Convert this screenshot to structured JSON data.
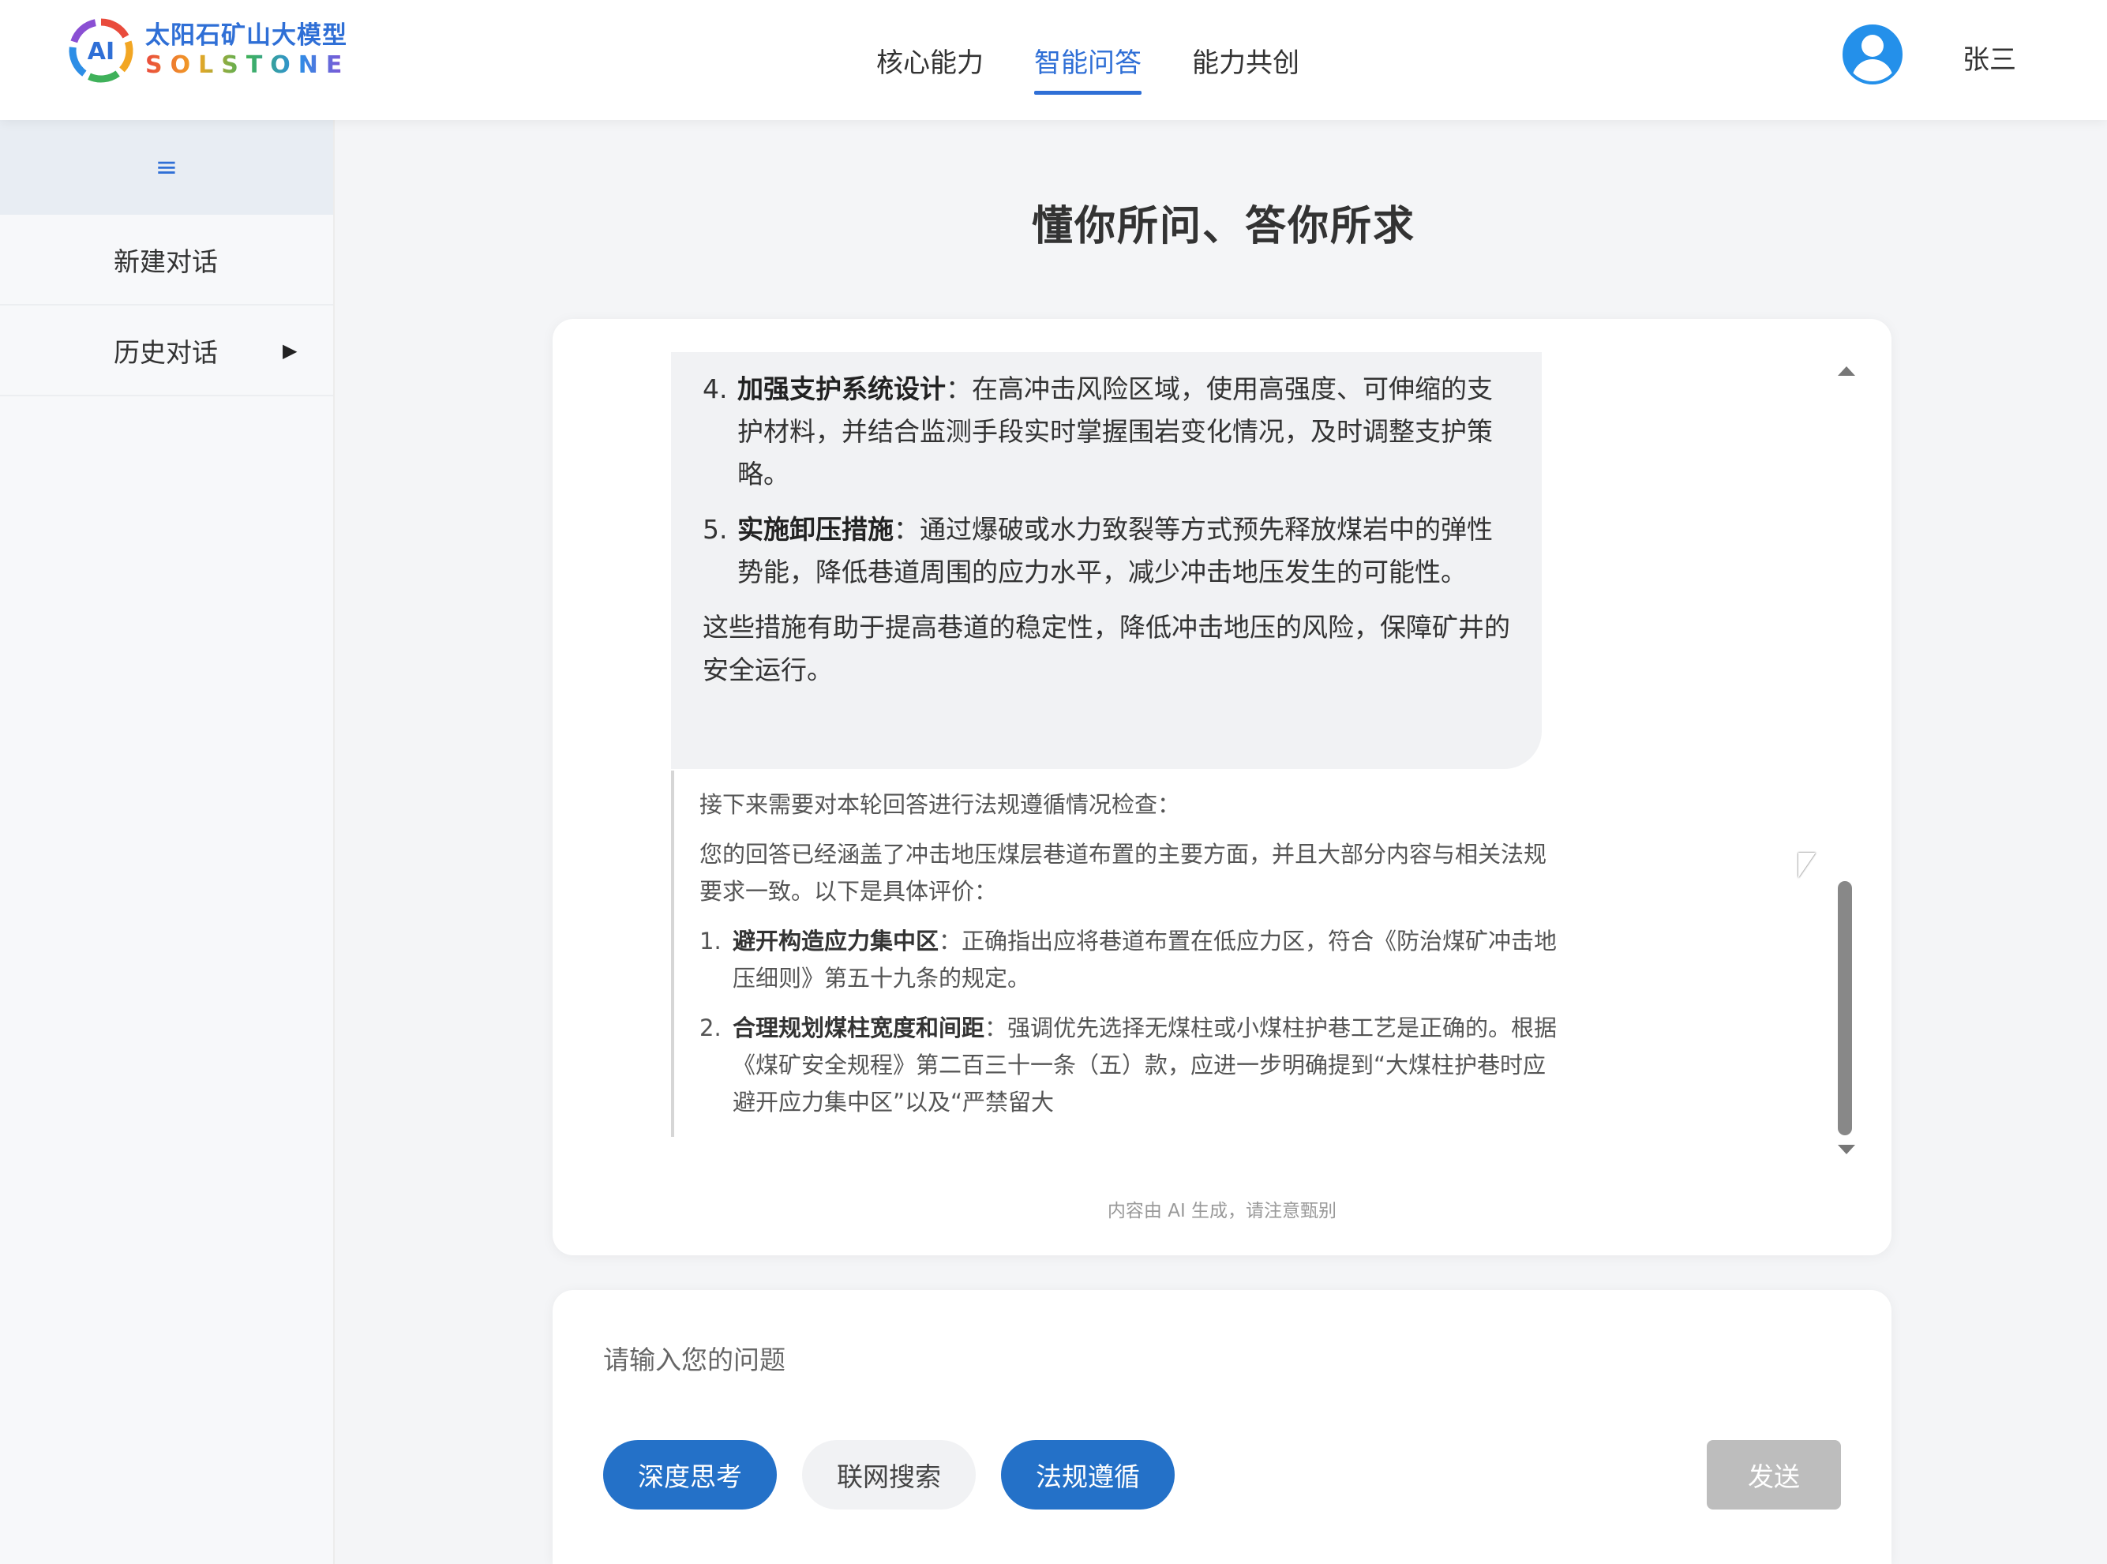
{
  "brand": {
    "name_cn": "太阳石矿山大模型",
    "name_en": "SOLSTONE",
    "mark_text": "AI"
  },
  "nav": [
    {
      "label": "核心能力",
      "active": false
    },
    {
      "label": "智能问答",
      "active": true
    },
    {
      "label": "能力共创",
      "active": false
    }
  ],
  "user": {
    "name": "张三",
    "avatar_icon": "user-circle-icon"
  },
  "sidebar": {
    "toggle_icon": "≡",
    "items": [
      {
        "label": "新建对话"
      },
      {
        "label": "历史对话",
        "arrow": "▶"
      }
    ]
  },
  "main": {
    "title": "懂你所问、答你所求"
  },
  "answer": {
    "items": [
      {
        "num": "4.",
        "title": "加强支护系统设计",
        "text": "：在高冲击风险区域，使用高强度、可伸缩的支护材料，并结合监测手段实时掌握围岩变化情况，及时调整支护策略。"
      },
      {
        "num": "5.",
        "title": "实施卸压措施",
        "text": "：通过爆破或水力致裂等方式预先释放煤岩中的弹性势能，降低巷道周围的应力水平，减少冲击地压发生的可能性。"
      }
    ],
    "conclusion": "这些措施有助于提高巷道的稳定性，降低冲击地压的风险，保障矿井的安全运行。"
  },
  "compliance": {
    "intro": "接下来需要对本轮回答进行法规遵循情况检查：",
    "summary": "您的回答已经涵盖了冲击地压煤层巷道布置的主要方面，并且大部分内容与相关法规要求一致。以下是具体评价：",
    "items": [
      {
        "num": "1.",
        "title": "避开构造应力集中区",
        "text": "：正确指出应将巷道布置在低应力区，符合《防治煤矿冲击地压细则》第五十九条的规定。"
      },
      {
        "num": "2.",
        "title": "合理规划煤柱宽度和间距",
        "text": "：强调优先选择无煤柱或小煤柱护巷工艺是正确的。根据《煤矿安全规程》第二百三十一条（五）款，应进一步明确提到“大煤柱护巷时应避开应力集中区”以及“严禁留大"
      }
    ]
  },
  "disclaimer": "内容由 AI 生成，请注意甄别",
  "input": {
    "placeholder": "请输入您的问题",
    "buttons": [
      {
        "label": "深度思考",
        "active": true
      },
      {
        "label": "联网搜索",
        "active": false
      },
      {
        "label": "法规遵循",
        "active": true
      }
    ],
    "send_label": "发送",
    "send_disabled": true
  }
}
